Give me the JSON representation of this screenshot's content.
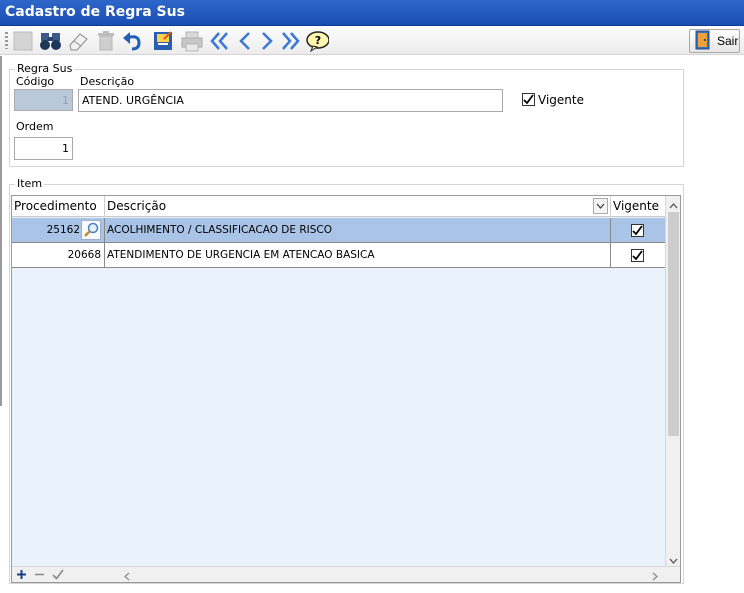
{
  "window": {
    "title": "Cadastro de Regra Sus"
  },
  "toolbar": {
    "buttons": [
      "new-icon",
      "find-icon",
      "eraser-icon",
      "delete-icon",
      "undo-icon",
      "save-icon",
      "print-icon",
      "first-icon",
      "previous-icon",
      "next-icon",
      "last-icon",
      "help-icon"
    ],
    "sair_label": "Sair"
  },
  "regra": {
    "legend": "Regra Sus",
    "codigo_label": "Código",
    "codigo_value": "1",
    "descricao_label": "Descrição",
    "descricao_value": "ATEND. URGÊNCIA",
    "vigente_label": "Vigente",
    "vigente_checked": true,
    "ordem_label": "Ordem",
    "ordem_value": "1"
  },
  "item": {
    "legend": "Item",
    "columns": {
      "procedimento": "Procedimento",
      "descricao": "Descrição",
      "vigente": "Vigente"
    },
    "rows": [
      {
        "procedimento": "25162",
        "descricao": "ACOLHIMENTO / CLASSIFICACAO DE RISCO",
        "vigente": true,
        "selected": true
      },
      {
        "procedimento": "20668",
        "descricao": "ATENDIMENTO DE URGENCIA EM ATENCAO BASICA",
        "vigente": true,
        "selected": false
      }
    ]
  },
  "colors": {
    "title_bar": "#1a4db3",
    "selected_row": "#a9c4e6",
    "grid_bg": "#eaf3fb"
  }
}
